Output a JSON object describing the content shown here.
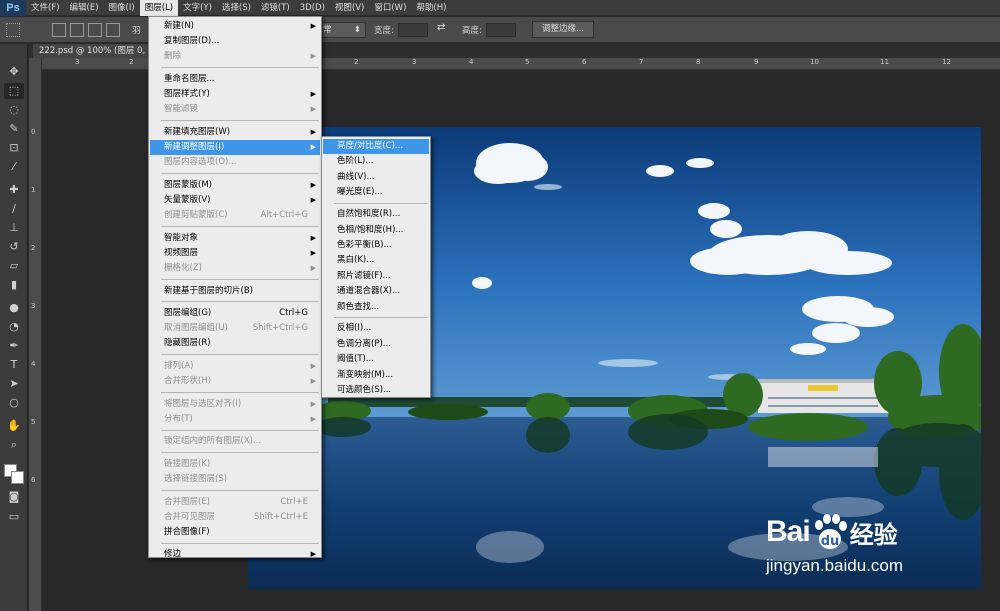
{
  "app": {
    "logo": "Ps"
  },
  "menubar": {
    "items": [
      "文件(F)",
      "编辑(E)",
      "图像(I)",
      "图层(L)",
      "文字(Y)",
      "选择(S)",
      "滤镜(T)",
      "3D(D)",
      "视图(V)",
      "窗口(W)",
      "帮助(H)"
    ],
    "active": "图层(L)"
  },
  "options": {
    "feather_label": "羽",
    "style_value": "常",
    "width_label": "宽度:",
    "height_label": "高度:",
    "refine_edge": "调整边缘..."
  },
  "document": {
    "tab_label": "222.psd @ 100% (图层 0, R"
  },
  "rulers": {
    "top": [
      "3",
      "2",
      "1",
      "0",
      "1",
      "2",
      "3",
      "4",
      "5",
      "6",
      "7",
      "8",
      "9",
      "10",
      "11",
      "12"
    ],
    "left": [
      "0",
      "1",
      "2",
      "3",
      "4",
      "5",
      "6"
    ]
  },
  "layer_menu": [
    {
      "label": "新建(N)",
      "arrow": true
    },
    {
      "label": "复制图层(D)..."
    },
    {
      "label": "删除",
      "arrow": true,
      "disabled": true
    },
    {
      "sep": true
    },
    {
      "label": "重命名图层..."
    },
    {
      "label": "图层样式(Y)",
      "arrow": true
    },
    {
      "label": "智能滤镜",
      "arrow": true,
      "disabled": true
    },
    {
      "sep": true
    },
    {
      "label": "新建填充图层(W)",
      "arrow": true
    },
    {
      "label": "新建调整图层(J)",
      "arrow": true,
      "highlight": true
    },
    {
      "label": "图层内容选项(O)...",
      "disabled": true
    },
    {
      "sep": true
    },
    {
      "label": "图层蒙版(M)",
      "arrow": true
    },
    {
      "label": "矢量蒙版(V)",
      "arrow": true
    },
    {
      "label": "创建剪贴蒙版(C)",
      "shortcut": "Alt+Ctrl+G",
      "disabled": true
    },
    {
      "sep": true
    },
    {
      "label": "智能对象",
      "arrow": true
    },
    {
      "label": "视频图层",
      "arrow": true
    },
    {
      "label": "栅格化(Z)",
      "arrow": true,
      "disabled": true
    },
    {
      "sep": true
    },
    {
      "label": "新建基于图层的切片(B)"
    },
    {
      "sep": true
    },
    {
      "label": "图层编组(G)",
      "shortcut": "Ctrl+G"
    },
    {
      "label": "取消图层编组(U)",
      "shortcut": "Shift+Ctrl+G",
      "disabled": true
    },
    {
      "label": "隐藏图层(R)"
    },
    {
      "sep": true
    },
    {
      "label": "排列(A)",
      "arrow": true,
      "disabled": true
    },
    {
      "label": "合并形状(H)",
      "arrow": true,
      "disabled": true
    },
    {
      "sep": true
    },
    {
      "label": "将图层与选区对齐(I)",
      "arrow": true,
      "disabled": true
    },
    {
      "label": "分布(T)",
      "arrow": true,
      "disabled": true
    },
    {
      "sep": true
    },
    {
      "label": "锁定组内的所有图层(X)...",
      "disabled": true
    },
    {
      "sep": true
    },
    {
      "label": "链接图层(K)",
      "disabled": true
    },
    {
      "label": "选择链接图层(S)",
      "disabled": true
    },
    {
      "sep": true
    },
    {
      "label": "合并图层(E)",
      "shortcut": "Ctrl+E",
      "disabled": true
    },
    {
      "label": "合并可见图层",
      "shortcut": "Shift+Ctrl+E",
      "disabled": true
    },
    {
      "label": "拼合图像(F)"
    },
    {
      "sep": true
    },
    {
      "label": "修边",
      "arrow": true
    }
  ],
  "adjustment_menu": [
    {
      "label": "亮度/对比度(C)...",
      "highlight": true
    },
    {
      "label": "色阶(L)..."
    },
    {
      "label": "曲线(V)..."
    },
    {
      "label": "曝光度(E)..."
    },
    {
      "sep": true
    },
    {
      "label": "自然饱和度(R)..."
    },
    {
      "label": "色相/饱和度(H)..."
    },
    {
      "label": "色彩平衡(B)..."
    },
    {
      "label": "黑白(K)..."
    },
    {
      "label": "照片滤镜(F)..."
    },
    {
      "label": "通道混合器(X)..."
    },
    {
      "label": "颜色查找..."
    },
    {
      "sep": true
    },
    {
      "label": "反相(I)..."
    },
    {
      "label": "色调分离(P)..."
    },
    {
      "label": "阈值(T)..."
    },
    {
      "label": "渐变映射(M)..."
    },
    {
      "label": "可选颜色(S)..."
    }
  ],
  "watermark": {
    "brand": "Bai",
    "brand2": "经验",
    "url": "jingyan.baidu.com"
  },
  "colors": {
    "highlight": "#3d96e9",
    "menu_bg": "#ececec",
    "workspace": "#282828"
  }
}
